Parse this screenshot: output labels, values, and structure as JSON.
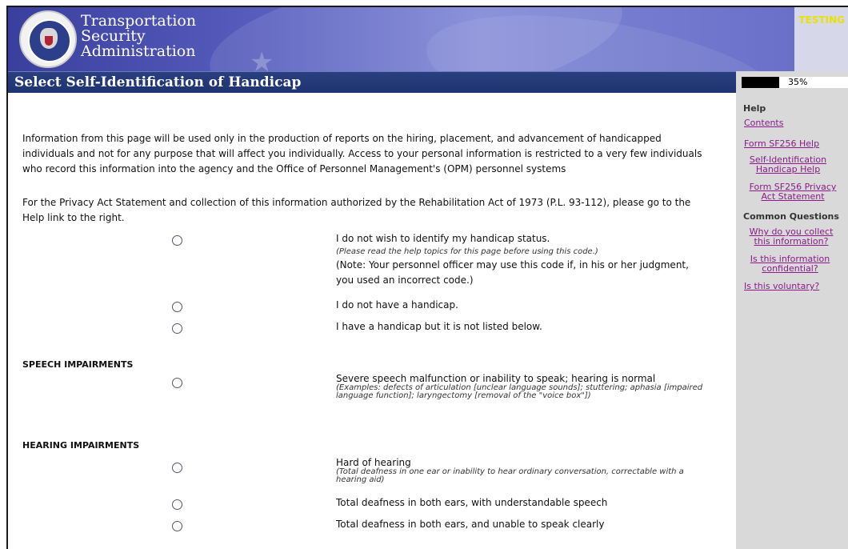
{
  "header": {
    "agency_lines": [
      "Transportation",
      "Security",
      "Administration"
    ],
    "env_label": "TESTING",
    "page_title": "Select Self-Identification of Handicap"
  },
  "progress": {
    "percent": 35,
    "label": "35%"
  },
  "sidebar": {
    "help_heading": "Help",
    "links": [
      "Contents",
      "Form SF256 Help",
      "Self-Identification Handicap Help",
      "Form SF256 Privacy Act Statement"
    ],
    "questions_heading": "Common Questions",
    "questions": [
      "Why do you collect this information?",
      "Is this information confidential?",
      "Is this voluntary?"
    ]
  },
  "intro": {
    "p1": "Information from this page will be used only in the production of reports on the hiring, placement, and advancement of handicapped individuals and not for any purpose that will affect you individually. Access to your personal information is restricted to a very few individuals who record this information into the agency and the Office of Personnel Management's (OPM) personnel systems",
    "p2": "For the Privacy Act Statement and collection of this information authorized by the Rehabilitation Act of 1973 (P.L. 93-112), please go to the Help link to the right."
  },
  "options": {
    "no_wish": "I do not wish to identify my handicap status.",
    "no_wish_hint": "(Please read the help topics for this page before using this code.)",
    "no_wish_note": "(Note: Your personnel officer may use this code if, in his or her judgment, you used an incorrect code.)",
    "no_handicap": "I do not have a handicap.",
    "not_listed": "I have a handicap but it is not listed below."
  },
  "sections": {
    "speech": {
      "heading": "SPEECH IMPAIRMENTS",
      "item": "Severe speech malfunction or inability to speak; hearing is normal",
      "hint": "(Examples: defects of articulation [unclear language sounds]; stuttering; aphasia [impaired language function]; laryngectomy [removal of the \"voice box\"])"
    },
    "hearing": {
      "heading": "HEARING IMPAIRMENTS",
      "items": [
        {
          "label": "Hard of hearing",
          "hint": "(Total deafness in one ear or inability to hear ordinary conversation, correctable with a hearing aid)"
        },
        {
          "label": "Total deafness in both ears, with understandable speech"
        },
        {
          "label": "Total deafness in both ears, and unable to speak clearly"
        }
      ]
    }
  }
}
